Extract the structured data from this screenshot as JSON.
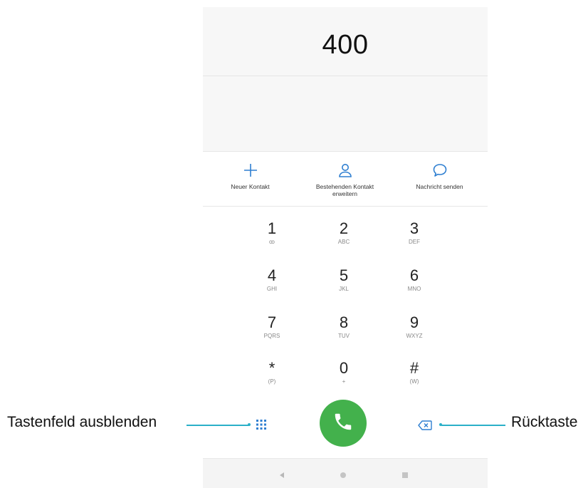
{
  "display": {
    "number": "400"
  },
  "actions": [
    {
      "icon": "plus-icon",
      "label": "Neuer Kontakt"
    },
    {
      "icon": "person-icon",
      "label": "Bestehenden Kontakt erweitern"
    },
    {
      "icon": "message-bubble-icon",
      "label": "Nachricht senden"
    }
  ],
  "keypad": [
    {
      "digit": "1",
      "letters": "ꝏ"
    },
    {
      "digit": "2",
      "letters": "ABC"
    },
    {
      "digit": "3",
      "letters": "DEF"
    },
    {
      "digit": "4",
      "letters": "GHI"
    },
    {
      "digit": "5",
      "letters": "JKL"
    },
    {
      "digit": "6",
      "letters": "MNO"
    },
    {
      "digit": "7",
      "letters": "PQRS"
    },
    {
      "digit": "8",
      "letters": "TUV"
    },
    {
      "digit": "9",
      "letters": "WXYZ"
    },
    {
      "digit": "*",
      "letters": "(P)"
    },
    {
      "digit": "0",
      "letters": "+"
    },
    {
      "digit": "#",
      "letters": "(W)"
    }
  ],
  "callouts": {
    "hide_keypad": "Tastenfeld ausblenden",
    "backspace": "Rücktaste"
  },
  "colors": {
    "accent": "#2f7fd1",
    "call_button": "#43b14c",
    "leader_line": "#2bb0c8"
  }
}
